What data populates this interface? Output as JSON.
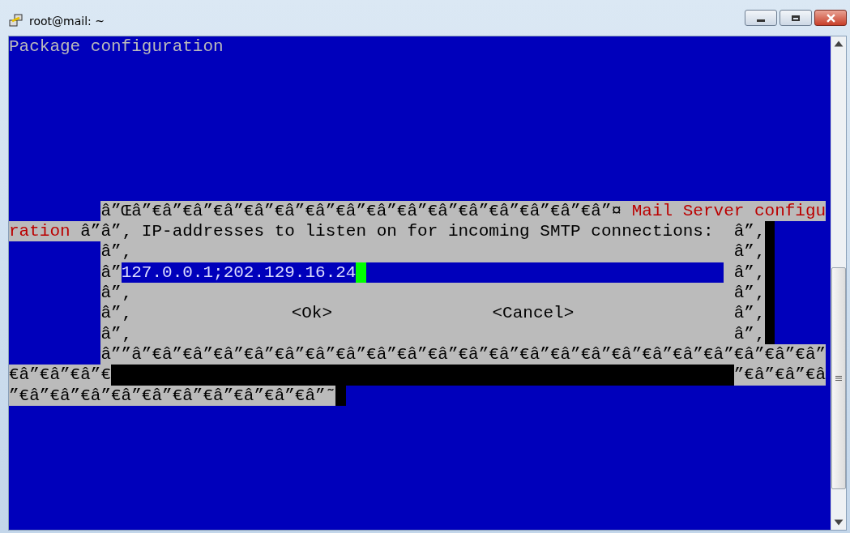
{
  "window": {
    "title": "root@mail: ~"
  },
  "terminal": {
    "header": "Package configuration",
    "dialog_lines": [
      {
        "segments": [
          {
            "kind": "indent"
          },
          {
            "kind": "border",
            "text": "â”Œâ”€â”€â”€â”€â”€â”€â”€â”€â”€â”€â”€â”€â”€â”€â”€â”¤ "
          },
          {
            "kind": "title",
            "text": "Mail Server configu"
          }
        ]
      },
      {
        "segments": [
          {
            "kind": "title",
            "text": "ration "
          },
          {
            "kind": "border",
            "text": "â”â”‚ IP-addresses to listen on for incoming SMTP connections:  â”‚"
          },
          {
            "kind": "shadow"
          }
        ]
      },
      {
        "segments": [
          {
            "kind": "indent"
          },
          {
            "kind": "border",
            "text": "â”‚"
          },
          {
            "kind": "pad"
          },
          {
            "kind": "border",
            "text": "â”‚"
          },
          {
            "kind": "shadow"
          }
        ]
      },
      {
        "segments": [
          {
            "kind": "indent"
          },
          {
            "kind": "border",
            "text": "â”"
          },
          {
            "kind": "field",
            "text": "127.0.0.1;202.129.16.24"
          },
          {
            "kind": "gap"
          },
          {
            "kind": "border",
            "text": "â”‚"
          },
          {
            "kind": "shadow"
          }
        ]
      },
      {
        "segments": [
          {
            "kind": "indent"
          },
          {
            "kind": "border",
            "text": "â”‚"
          },
          {
            "kind": "pad"
          },
          {
            "kind": "border",
            "text": "â”‚"
          },
          {
            "kind": "shadow"
          }
        ]
      },
      {
        "segments": [
          {
            "kind": "indent"
          },
          {
            "kind": "border",
            "text": "â”‚"
          },
          {
            "kind": "pad"
          },
          {
            "kind": "button",
            "text": "<Ok>"
          },
          {
            "kind": "pad"
          },
          {
            "kind": "button",
            "text": "<Cancel>"
          },
          {
            "kind": "pad"
          },
          {
            "kind": "border",
            "text": "â”‚"
          },
          {
            "kind": "shadow"
          }
        ]
      },
      {
        "segments": [
          {
            "kind": "indent"
          },
          {
            "kind": "border",
            "text": "â”‚"
          },
          {
            "kind": "pad"
          },
          {
            "kind": "border",
            "text": "â”‚"
          },
          {
            "kind": "shadow"
          }
        ]
      },
      {
        "segments": [
          {
            "kind": "indent"
          },
          {
            "kind": "border",
            "text": "â””â”€â”€â”€â”€â”€â”€â”€â”€â”€â”€â”€â”€â”€â”€â”€â”€â”€â”€â”€â”€â”€â”€â”"
          }
        ]
      },
      {
        "segments": [
          {
            "kind": "border",
            "text": "€â”€â”€â”€"
          },
          {
            "kind": "shadow-fill"
          },
          {
            "kind": "border",
            "text": "”€â”€â”€â"
          }
        ]
      },
      {
        "segments": [
          {
            "kind": "border",
            "text": "”€â”€â”€â”€â”€â”€â”€â”€â”€â”€â”˜"
          },
          {
            "kind": "shadow"
          }
        ]
      }
    ]
  }
}
